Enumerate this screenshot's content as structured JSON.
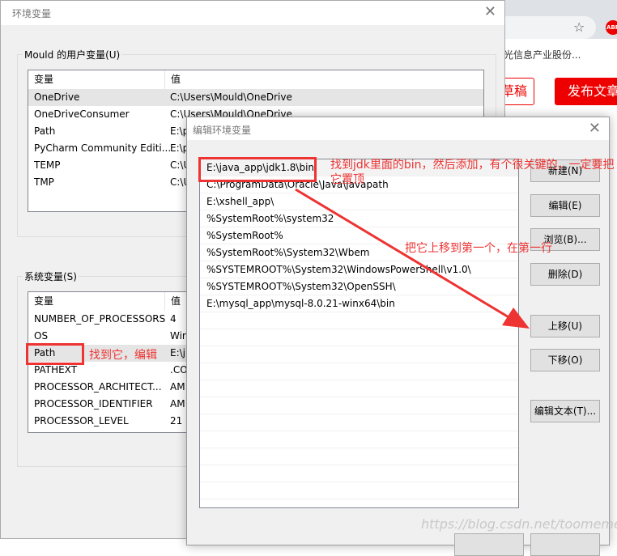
{
  "browser": {
    "company": "光信息产业股份...",
    "draft": "草稿",
    "publish": "发布文章",
    "star_icon": "star-icon",
    "abp": "ABP"
  },
  "env_dialog": {
    "title": "环境变量",
    "user_group": "Mould 的用户变量(U)",
    "sys_group": "系统变量(S)",
    "col_var": "变量",
    "col_val": "值",
    "user_vars": [
      {
        "name": "OneDrive",
        "value": "C:\\Users\\Mould\\OneDrive"
      },
      {
        "name": "OneDriveConsumer",
        "value": "C:\\Users\\Mould\\OneDrive"
      },
      {
        "name": "Path",
        "value": "E:\\p"
      },
      {
        "name": "PyCharm Community Editi...",
        "value": "E:\\p"
      },
      {
        "name": "TEMP",
        "value": "C:\\U"
      },
      {
        "name": "TMP",
        "value": "C:\\U"
      }
    ],
    "sys_vars": [
      {
        "name": "NUMBER_OF_PROCESSORS",
        "value": "4"
      },
      {
        "name": "OS",
        "value": "Wir"
      },
      {
        "name": "Path",
        "value": "E:\\j"
      },
      {
        "name": "PATHEXT",
        "value": ".CO"
      },
      {
        "name": "PROCESSOR_ARCHITECT...",
        "value": "AM"
      },
      {
        "name": "PROCESSOR_IDENTIFIER",
        "value": "AM"
      },
      {
        "name": "PROCESSOR_LEVEL",
        "value": "21"
      }
    ]
  },
  "edit_dialog": {
    "title": "编辑环境变量",
    "paths": [
      "E:\\java_app\\jdk1.8\\bin",
      "C:\\ProgramData\\Oracle\\Java\\javapath",
      "E:\\xshell_app\\",
      "%SystemRoot%\\system32",
      "%SystemRoot%",
      "%SystemRoot%\\System32\\Wbem",
      "%SYSTEMROOT%\\System32\\WindowsPowerShell\\v1.0\\",
      "%SYSTEMROOT%\\System32\\OpenSSH\\",
      "E:\\mysql_app\\mysql-8.0.21-winx64\\bin",
      "",
      "",
      "",
      "",
      "",
      "",
      "",
      "",
      "",
      "",
      ""
    ],
    "buttons": {
      "new": "新建(N)",
      "edit": "编辑(E)",
      "browse": "浏览(B)...",
      "delete": "删除(D)",
      "up": "上移(U)",
      "down": "下移(O)",
      "edit_text": "编辑文本(T)..."
    }
  },
  "annotations": {
    "jdk_note": "找到jdk里面的bin，然后添加，有个很关键的，一定要把它置顶",
    "move_note": "把它上移到第一个，在第一行",
    "path_note": "找到它，编辑",
    "color": "#e33333"
  },
  "watermark": "https://blog.csdn.net/toomemetoo"
}
